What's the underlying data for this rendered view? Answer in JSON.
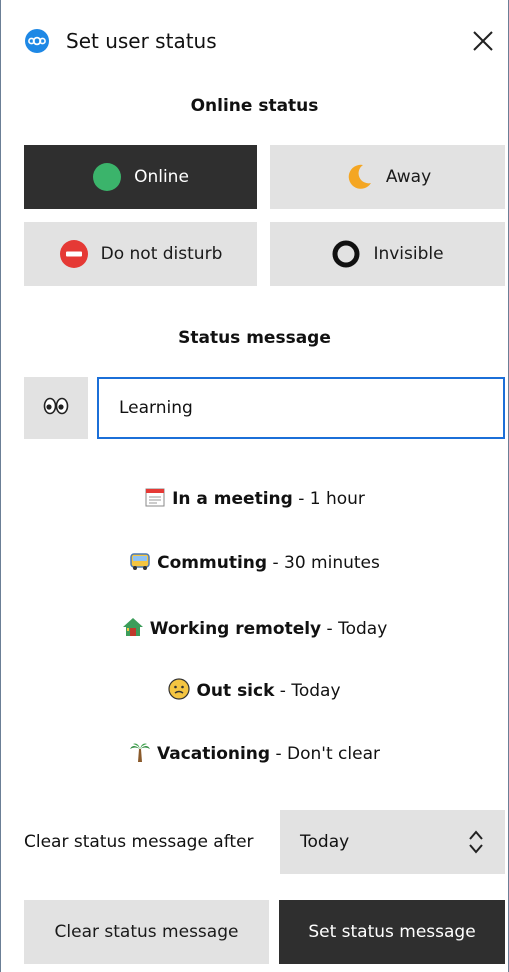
{
  "window": {
    "title": "Set user status",
    "close_icon": "close-icon",
    "logo_icon": "nextcloud-logo-icon"
  },
  "online_status": {
    "heading": "Online status",
    "options": [
      {
        "label": "Online",
        "icon": "green-dot-icon",
        "selected": true
      },
      {
        "label": "Away",
        "icon": "moon-icon",
        "selected": false
      },
      {
        "label": "Do not disturb",
        "icon": "no-entry-icon",
        "selected": false
      },
      {
        "label": "Invisible",
        "icon": "ring-icon",
        "selected": false
      }
    ]
  },
  "status_message": {
    "heading": "Status message",
    "emoji": "👀",
    "input_value": "Learning"
  },
  "presets": [
    {
      "icon": "calendar-icon",
      "label": "In a meeting",
      "duration": " - 1 hour"
    },
    {
      "icon": "bus-icon",
      "label": "Commuting",
      "duration": " - 30 minutes"
    },
    {
      "icon": "house-icon",
      "label": "Working remotely",
      "duration": " - Today"
    },
    {
      "icon": "sick-face-icon",
      "label": "Out sick",
      "duration": " - Today"
    },
    {
      "icon": "palm-tree-icon",
      "label": "Vacationing",
      "duration": " - Don't clear"
    }
  ],
  "clear_after": {
    "label": "Clear status message after",
    "selected": "Today"
  },
  "actions": {
    "clear_label": "Clear status message",
    "set_label": "Set status message"
  },
  "colors": {
    "accent": "#1b6fd8",
    "dark_button": "#2f2f2f",
    "light_button": "#e2e2e2",
    "online": "#3bb46b",
    "away": "#f4a623",
    "dnd": "#e53935"
  }
}
